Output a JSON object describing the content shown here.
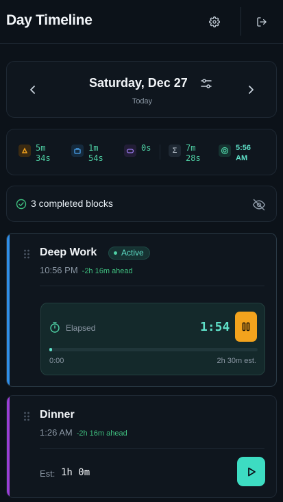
{
  "header": {
    "title": "Day Timeline",
    "settings_icon": "gear-icon",
    "logout_icon": "logout-icon"
  },
  "date_nav": {
    "date": "Saturday, Dec 27",
    "subtitle": "Today"
  },
  "stats": [
    {
      "icon": "flame-icon",
      "value_line1": "5m",
      "value_line2": "34s",
      "color": "#f3a31d"
    },
    {
      "icon": "briefcase-icon",
      "value_line1": "1m",
      "value_line2": "54s",
      "color": "#4aa3f0"
    },
    {
      "icon": "gamepad-icon",
      "value_line1": "0s",
      "value_line2": "",
      "color": "#9a7cf0"
    },
    {
      "icon": "sigma-icon",
      "value_line1": "7m",
      "value_line2": "28s",
      "color": "#c8d2dc"
    },
    {
      "icon": "target-icon",
      "value_line1": "5:56",
      "value_line2": "AM",
      "color": "#4fd1a5"
    }
  ],
  "completed": {
    "label": "3 completed blocks"
  },
  "tasks": [
    {
      "title": "Deep Work",
      "badge": "Active",
      "time": "10:56 PM",
      "ahead": "-2h 16m ahead",
      "accent": "#2f8ee8",
      "timer": {
        "label": "Elapsed",
        "value": "1:54",
        "start": "0:00",
        "end": "2h 30m est.",
        "progress": 0.013
      }
    },
    {
      "title": "Dinner",
      "time": "1:26 AM",
      "ahead": "-2h 16m ahead",
      "accent": "#9a3fd6",
      "est_label": "Est:",
      "est_value": "1h 0m"
    }
  ]
}
